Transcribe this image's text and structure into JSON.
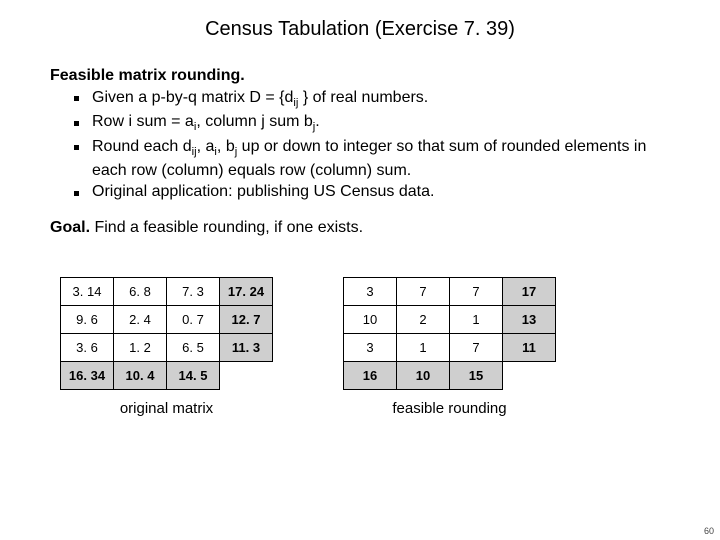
{
  "title": "Census Tabulation  (Exercise 7. 39)",
  "heading": "Feasible matrix rounding.",
  "bullets": [
    {
      "pre": "Given a p-by-q matrix D = {d",
      "sub": "ij",
      "post": " } of real numbers."
    },
    {
      "pre": "Row i sum = a",
      "sub": "i",
      "post": ", column j sum b",
      "sub2": "j",
      "post2": "."
    },
    {
      "pre": "Round each d",
      "sub": "ij",
      "post": ", a",
      "sub2": "i",
      "post2": ", b",
      "sub3": "j",
      "post3": "  up or down to integer so that sum of rounded elements in each row (column) equals row (column) sum."
    },
    {
      "pre": "Original application:  publishing US Census data."
    }
  ],
  "goal_bold": "Goal.",
  "goal_rest": "  Find a feasible rounding, if one exists.",
  "original": {
    "rows": [
      [
        "3. 14",
        "6. 8",
        "7. 3",
        "17. 24"
      ],
      [
        "9. 6",
        "2. 4",
        "0. 7",
        "12. 7"
      ],
      [
        "3. 6",
        "1. 2",
        "6. 5",
        "11. 3"
      ]
    ],
    "colsums": [
      "16. 34",
      "10. 4",
      "14. 5"
    ],
    "caption": "original matrix"
  },
  "rounded": {
    "rows": [
      [
        "3",
        "7",
        "7",
        "17"
      ],
      [
        "10",
        "2",
        "1",
        "13"
      ],
      [
        "3",
        "1",
        "7",
        "11"
      ]
    ],
    "colsums": [
      "16",
      "10",
      "15"
    ],
    "caption": "feasible rounding"
  },
  "page": "60"
}
